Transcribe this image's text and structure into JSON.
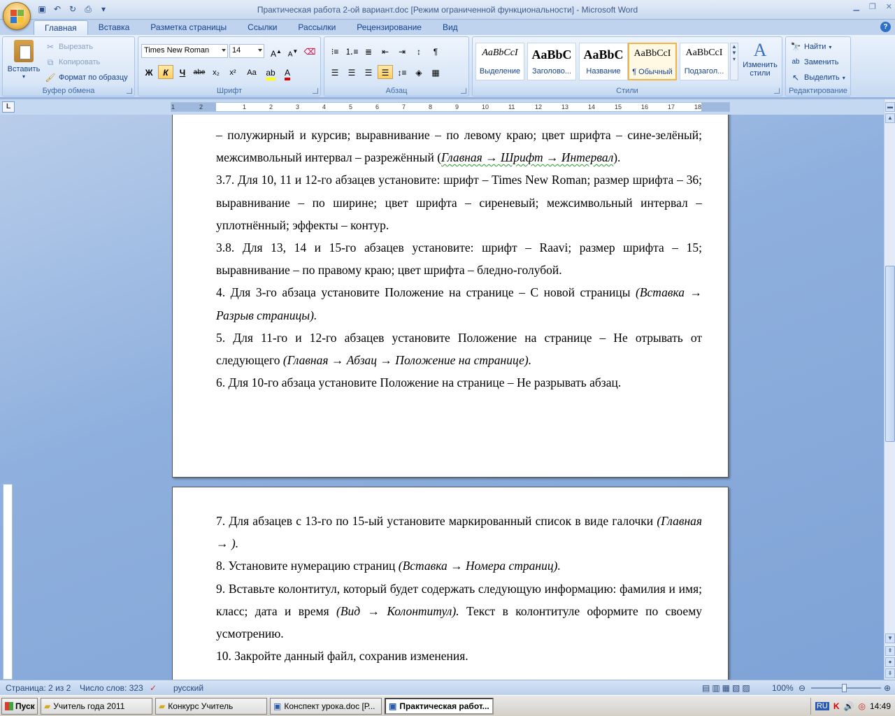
{
  "window": {
    "title": "Практическая работа 2-ой вариант.doc [Режим ограниченной функциональности] - Microsoft Word"
  },
  "tabs": [
    "Главная",
    "Вставка",
    "Разметка страницы",
    "Ссылки",
    "Рассылки",
    "Рецензирование",
    "Вид"
  ],
  "clipboard": {
    "paste": "Вставить",
    "cut": "Вырезать",
    "copy": "Копировать",
    "format_painter": "Формат по образцу",
    "label": "Буфер обмена"
  },
  "font": {
    "name": "Times New Roman",
    "size": "14",
    "bold": "Ж",
    "italic": "К",
    "underline": "Ч",
    "strike": "abe",
    "subscript": "x₂",
    "superscript": "x²",
    "case": "Aa",
    "label": "Шрифт"
  },
  "paragraph": {
    "label": "Абзац"
  },
  "styles": {
    "items": [
      {
        "sample": "AaBbCcI",
        "name": "Выделение"
      },
      {
        "sample": "AaBbC",
        "name": "Заголово..."
      },
      {
        "sample": "AaBbC",
        "name": "Название"
      },
      {
        "sample": "AaBbCcI",
        "name": "¶ Обычный"
      },
      {
        "sample": "AaBbCcI",
        "name": "Подзагол..."
      }
    ],
    "change": "Изменить стили",
    "label": "Стили"
  },
  "editing": {
    "find": "Найти",
    "replace": "Заменить",
    "select": "Выделить",
    "label": "Редактирование"
  },
  "ruler": {
    "numbers": [
      "1",
      "2",
      "1",
      "2",
      "3",
      "4",
      "5",
      "6",
      "7",
      "8",
      "9",
      "10",
      "11",
      "12",
      "13",
      "14",
      "15",
      "16",
      "17",
      "18"
    ]
  },
  "document": {
    "page1": {
      "p0": "– полужирный и курсив;  выравнивание – по левому краю; цвет шрифта – сине-зелёный; межсимвольный интервал – разрежённый",
      "p0_italic": "Главная → Шрифт → Интервал",
      "p1": "3.7. Для 10, 11 и 12-го абзацев установите: шрифт – Times New Roman;  размер шрифта – 36; выравнивание – по ширине; цвет шрифта – сиреневый; межсимвольный интервал – уплотнённый; эффекты – контур.",
      "p2": "3.8. Для 13, 14 и 15-го абзацев установите: шрифт – Raavi; размер шрифта – 15; выравнивание – по правому краю; цвет шрифта – бледно-голубой.",
      "p3": "4. Для 3-го абзаца установите Положение на странице – С новой страницы",
      "p3_italic": "(Вставка → Разрыв страницы).",
      "p4": "5. Для 11-го и 12-го абзацев установите Положение на странице – Не отрывать от следующего",
      "p4_italic": "(Главная → Абзац → Положение на странице).",
      "p5": "6. Для 10-го абзаца установите Положение на странице – Не разрывать абзац."
    },
    "page2": {
      "p1": "7. Для абзацев с 13-го по 15-ый установите маркированный список в виде галочки",
      "p1_italic": "(Главная → ).",
      "p2": "8.  Установите нумерацию страниц",
      "p2_italic": "(Вставка → Номера страниц).",
      "p3": "9. Вставьте колонтитул, который будет содержать следующую информацию: фамилия и имя; класс; дата и время",
      "p3_italic": "(Вид → Колонтитул).",
      "p3_tail": "Текст в колонтитуле оформите по своему усмотрению.",
      "p4": "10. Закройте данный файл, сохранив изменения."
    }
  },
  "status": {
    "page": "Страница: 2 из 2",
    "words": "Число слов: 323",
    "language": "русский",
    "zoom": "100%"
  },
  "taskbar": {
    "start": "Пуск",
    "tasks": [
      "Учитель года 2011",
      "Конкурс Учитель",
      "Конспект урока.doc [Р...",
      "Практическая работ..."
    ],
    "lang": "RU",
    "time": "14:49"
  }
}
